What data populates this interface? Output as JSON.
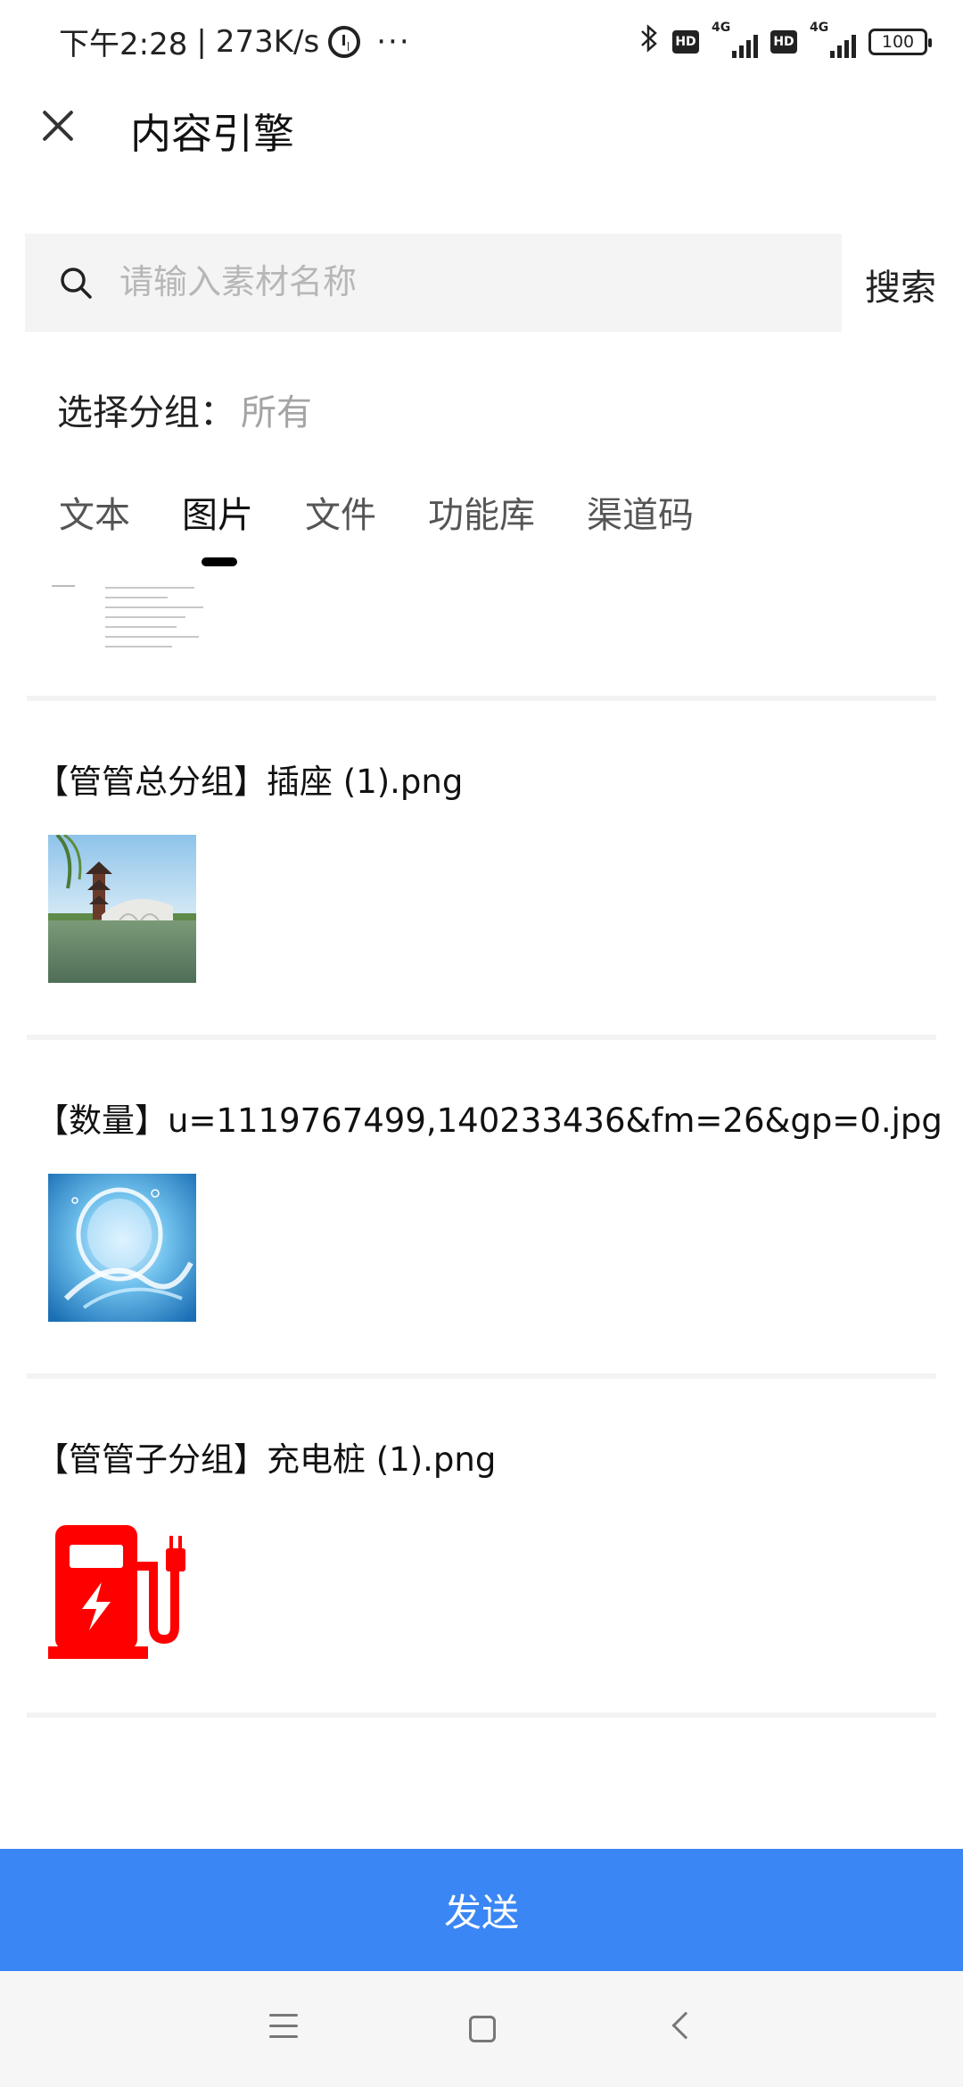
{
  "status_bar": {
    "time": "下午2:28",
    "net_speed": "273K/s",
    "more": "···",
    "hd_badge": "HD",
    "network_label": "4G",
    "battery": "100"
  },
  "header": {
    "title": "内容引擎"
  },
  "search": {
    "placeholder": "请输入素材名称",
    "value": "",
    "button_label": "搜索"
  },
  "group": {
    "label": "选择分组：",
    "value": "所有"
  },
  "tabs": [
    {
      "label": "文本",
      "active": false
    },
    {
      "label": "图片",
      "active": true
    },
    {
      "label": "文件",
      "active": false
    },
    {
      "label": "功能库",
      "active": false
    },
    {
      "label": "渠道码",
      "active": false
    }
  ],
  "items": [
    {
      "title": "【管管总分组】插座 (1).png",
      "thumb_icon": "pavilion-photo"
    },
    {
      "title": "【数量】u=1119767499,140233436&fm=26&gp=0.jpg",
      "thumb_icon": "water-splash-photo"
    },
    {
      "title": "【管管子分组】充电桩 (1).png",
      "thumb_icon": "charging-pile-icon"
    }
  ],
  "footer": {
    "send_label": "发送"
  },
  "colors": {
    "accent": "#3a86f5",
    "icon_red": "#ff0000"
  }
}
